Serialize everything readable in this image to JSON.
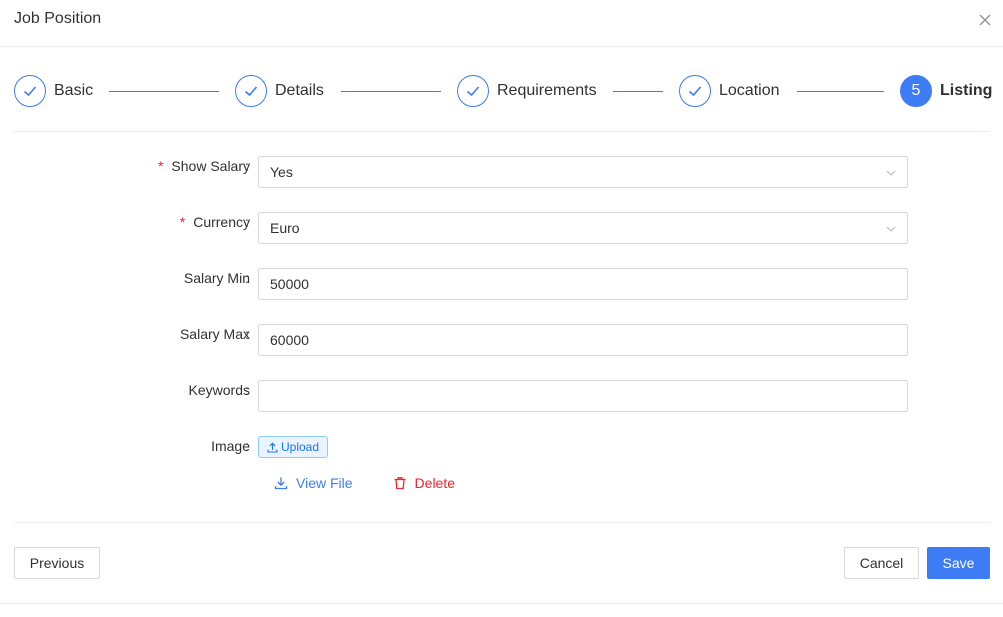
{
  "dialog": {
    "title": "Job Position"
  },
  "steps": [
    {
      "label": "Basic",
      "status": "done"
    },
    {
      "label": "Details",
      "status": "done"
    },
    {
      "label": "Requirements",
      "status": "done"
    },
    {
      "label": "Location",
      "status": "done"
    },
    {
      "label": "Listing",
      "status": "active",
      "number": "5"
    }
  ],
  "form": {
    "show_salary": {
      "label": "Show Salary",
      "value": "Yes",
      "required": true
    },
    "currency": {
      "label": "Currency",
      "value": "Euro",
      "required": true
    },
    "salary_min": {
      "label": "Salary Min",
      "value": "50000"
    },
    "salary_max": {
      "label": "Salary Max",
      "value": "60000"
    },
    "keywords": {
      "label": "Keywords",
      "value": ""
    },
    "image": {
      "label": "Image",
      "upload_label": "Upload",
      "view_label": "View File",
      "delete_label": "Delete"
    },
    "colon": ":",
    "required_mark": "*"
  },
  "footer": {
    "previous_label": "Previous",
    "cancel_label": "Cancel",
    "save_label": "Save"
  },
  "colors": {
    "primary": "#3d7cf5",
    "danger": "#f5222d",
    "border": "#d9d9d9"
  }
}
